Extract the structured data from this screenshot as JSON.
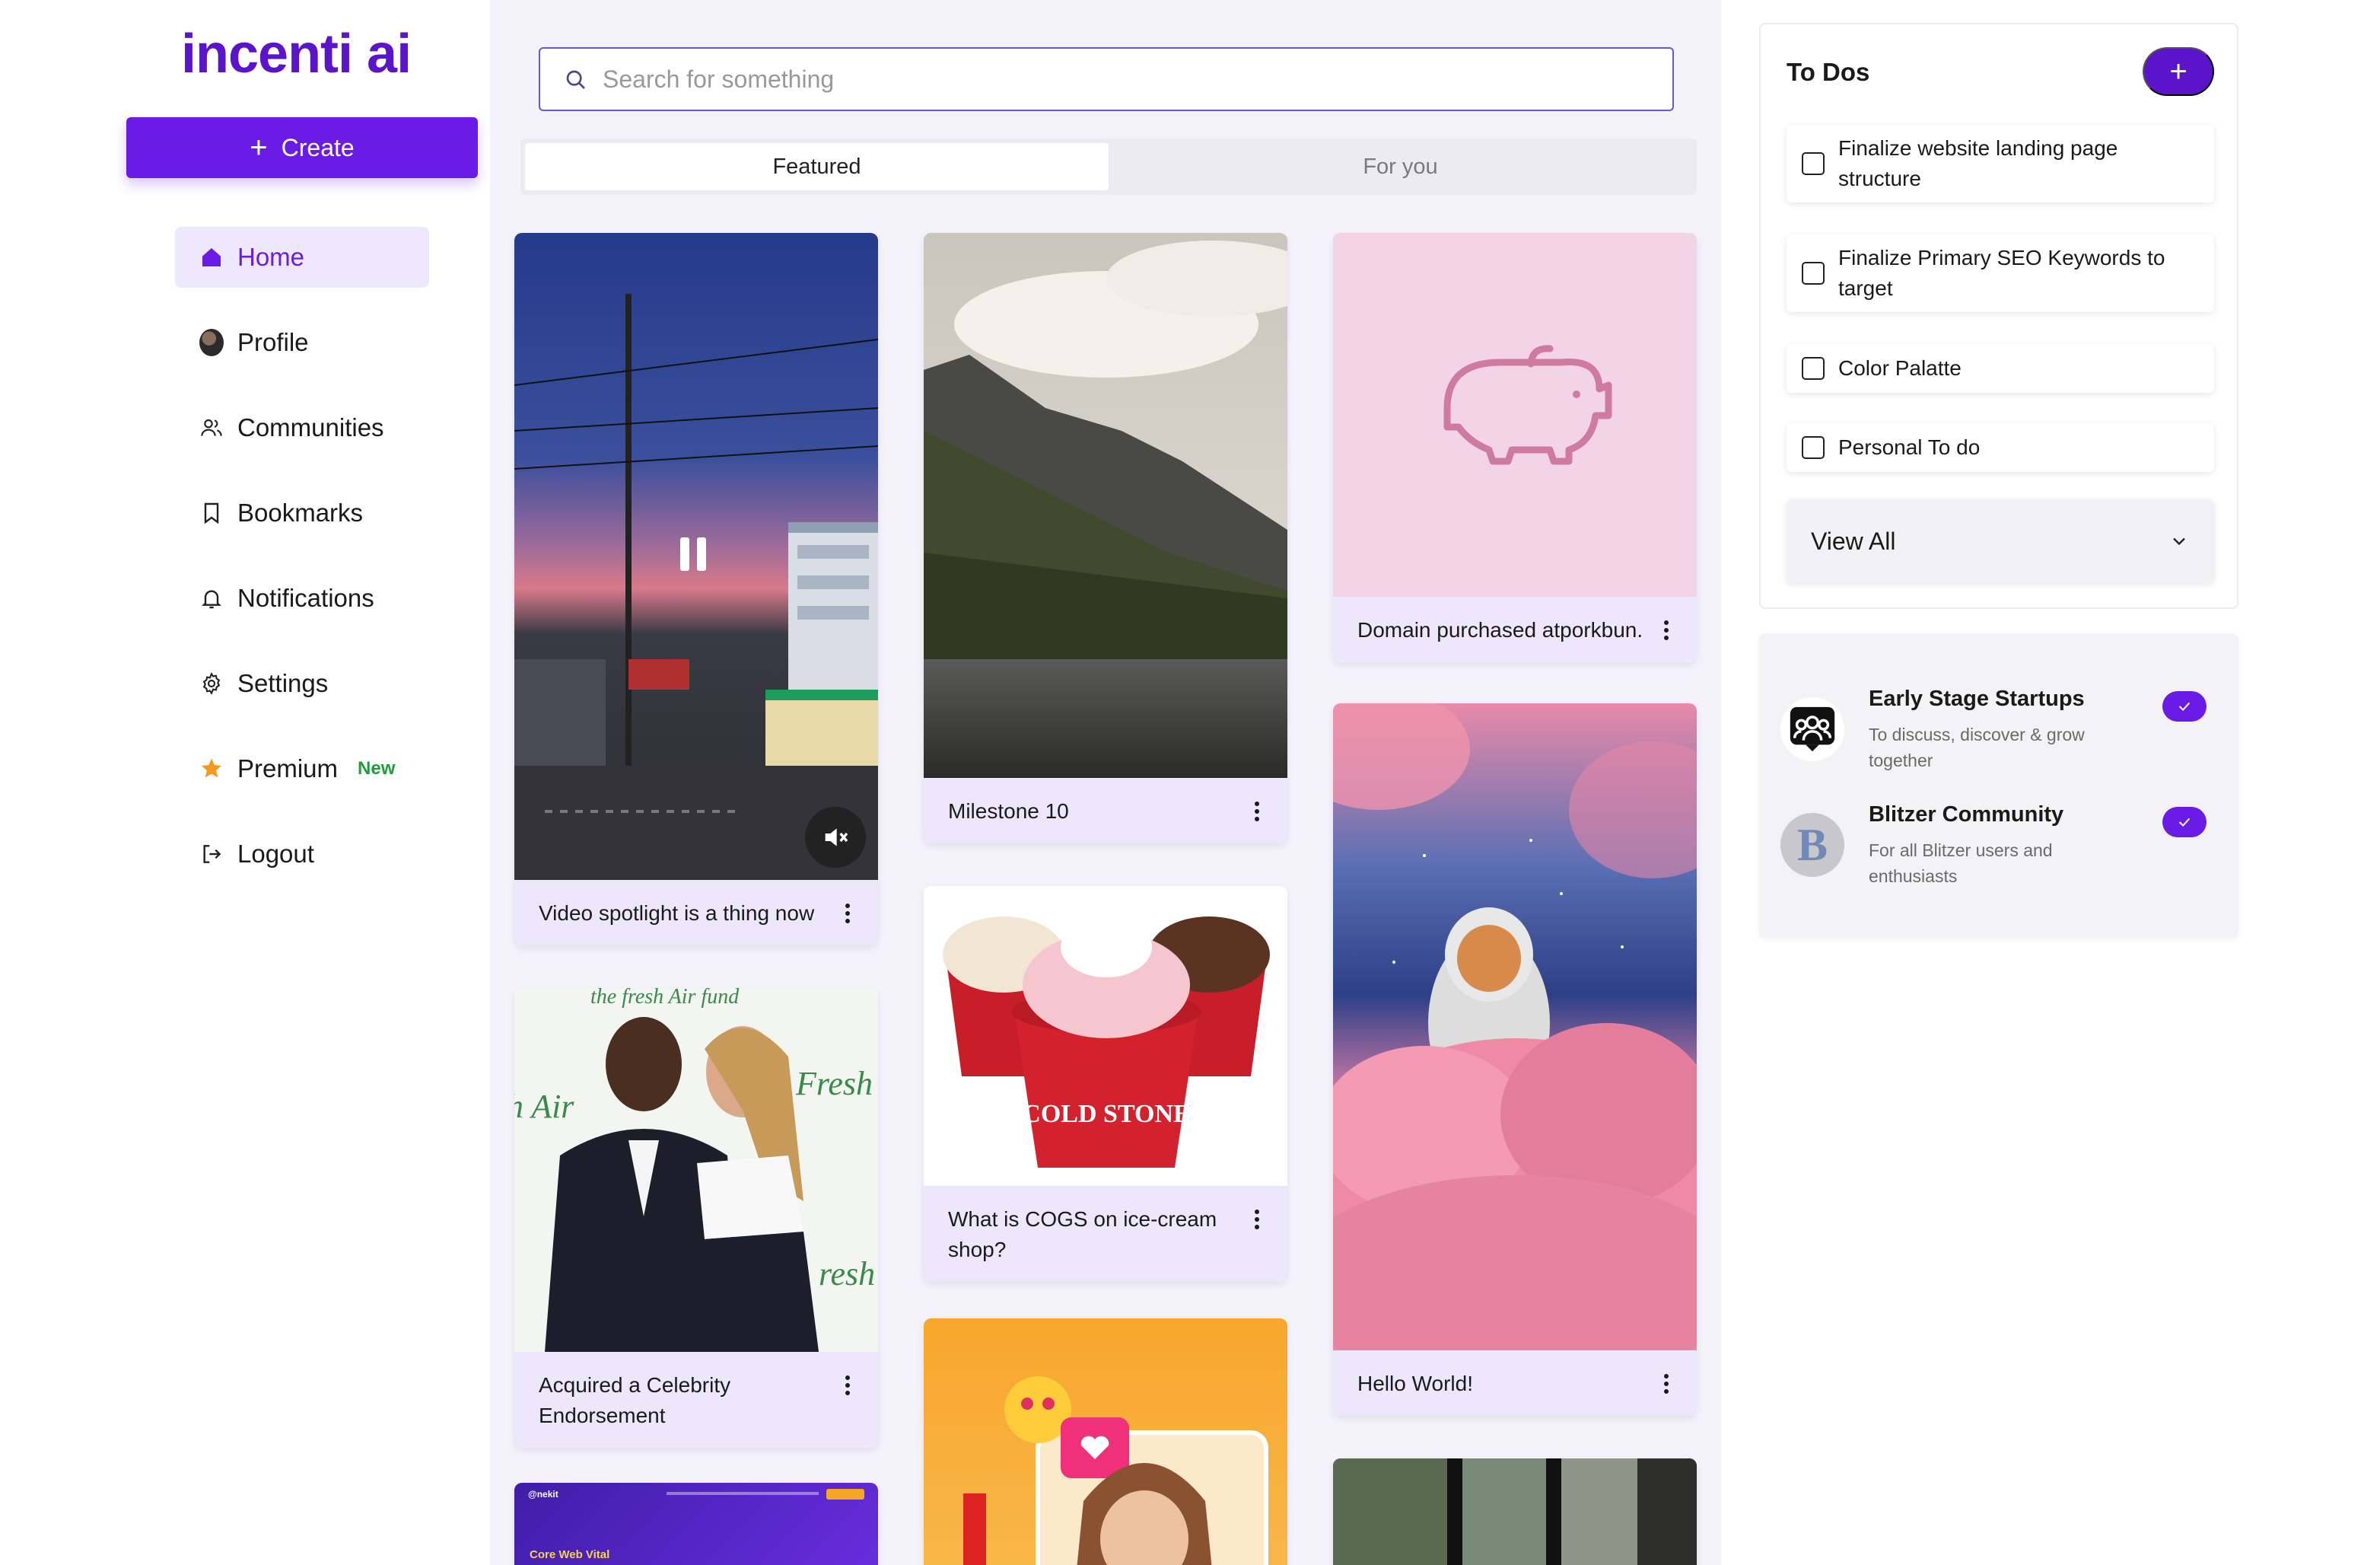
{
  "app": {
    "logo": "incenti ai"
  },
  "sidebar": {
    "create_label": "Create",
    "items": [
      {
        "label": "Home",
        "icon": "home-icon",
        "active": true
      },
      {
        "label": "Profile",
        "icon": "avatar"
      },
      {
        "label": "Communities",
        "icon": "users-icon"
      },
      {
        "label": "Bookmarks",
        "icon": "bookmark-icon"
      },
      {
        "label": "Notifications",
        "icon": "bell-icon"
      },
      {
        "label": "Settings",
        "icon": "gear-icon"
      },
      {
        "label": "Premium",
        "icon": "star-icon",
        "badge": "New"
      },
      {
        "label": "Logout",
        "icon": "logout-icon"
      }
    ]
  },
  "search": {
    "placeholder": "Search for something"
  },
  "tabs": [
    {
      "label": "Featured",
      "active": true
    },
    {
      "label": "For you"
    }
  ],
  "feed": {
    "cards": [
      {
        "caption": "Video spotlight is a thing now",
        "media": "video-street-dusk"
      },
      {
        "caption": "Acquired a Celebrity Endorsement",
        "media": "photo-couple-event"
      },
      {
        "caption": "Milestone 10",
        "media": "photo-mountain-lake"
      },
      {
        "caption": "What is COGS on ice-cream shop?",
        "media": "photo-ice-cream-cups"
      },
      {
        "caption": "Domain purchased atporkbun.",
        "media": "pig-icon"
      },
      {
        "caption": "Hello World!",
        "media": "photo-astronaut-clouds"
      }
    ],
    "partial": {
      "site_logo": "@nekit",
      "site_heading": "Core Web Vital"
    }
  },
  "todos": {
    "title": "To Dos",
    "items": [
      {
        "text": "Finalize website landing page structure"
      },
      {
        "text": "Finalize Primary SEO Keywords to target"
      },
      {
        "text": "Color Palatte"
      },
      {
        "text": "Personal To do"
      }
    ],
    "view_all": "View All"
  },
  "communities": [
    {
      "name": "Early Stage Startups",
      "desc": "To discuss, discover & grow together",
      "joined": true
    },
    {
      "name": "Blitzer Community",
      "desc": "For all Blitzer users and enthusiasts",
      "joined": true
    }
  ],
  "colors": {
    "brand": "#6a1be5",
    "brand_dark": "#5b14c9",
    "card_bg": "#ece7fb",
    "main_bg": "#f4f2fb"
  }
}
